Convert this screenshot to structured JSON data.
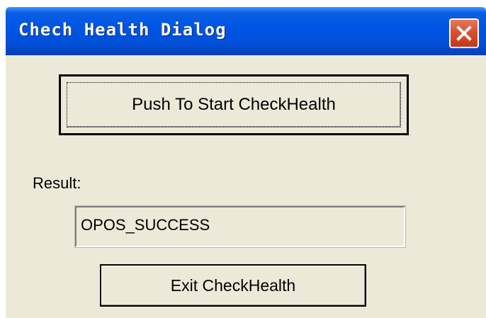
{
  "window": {
    "title": "Chech Health Dialog",
    "close_icon": "close-x-icon"
  },
  "dialog": {
    "start_button_label": "Push To Start CheckHealth",
    "result_label": "Result:",
    "result_value": "OPOS_SUCCESS",
    "exit_button_label": "Exit CheckHealth"
  },
  "colors": {
    "titlebar": "#0055e5",
    "background": "#ece9d8",
    "close_button": "#d9502e"
  }
}
